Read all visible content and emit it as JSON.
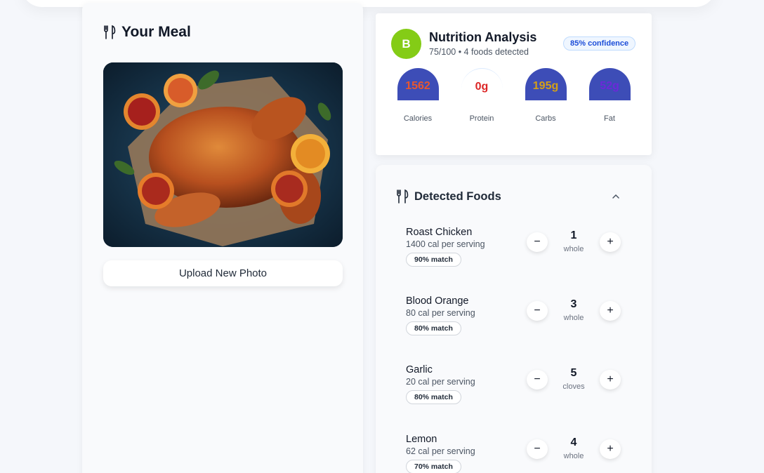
{
  "meal": {
    "title": "Your Meal",
    "upload_label": "Upload New Photo"
  },
  "nutrition": {
    "grade": "B",
    "title": "Nutrition Analysis",
    "subtitle": "75/100 • 4 foods detected",
    "confidence": "85% confidence",
    "macros": [
      {
        "value": "1562",
        "label": "Calories",
        "color": "#e8572e"
      },
      {
        "value": "0g",
        "label": "Protein",
        "color": "#dc2626"
      },
      {
        "value": "195g",
        "label": "Carbs",
        "color": "#d4a017"
      },
      {
        "value": "52g",
        "label": "Fat",
        "color": "#6d28d9"
      }
    ]
  },
  "foods": {
    "title": "Detected Foods",
    "items": [
      {
        "name": "Roast Chicken",
        "cal": "1400 cal per serving",
        "match": "90% match",
        "qty": "1",
        "unit": "whole"
      },
      {
        "name": "Blood Orange",
        "cal": "80 cal per serving",
        "match": "80% match",
        "qty": "3",
        "unit": "whole"
      },
      {
        "name": "Garlic",
        "cal": "20 cal per serving",
        "match": "80% match",
        "qty": "5",
        "unit": "cloves"
      },
      {
        "name": "Lemon",
        "cal": "62 cal per serving",
        "match": "70% match",
        "qty": "4",
        "unit": "whole"
      }
    ],
    "minus": "−",
    "plus": "+"
  }
}
